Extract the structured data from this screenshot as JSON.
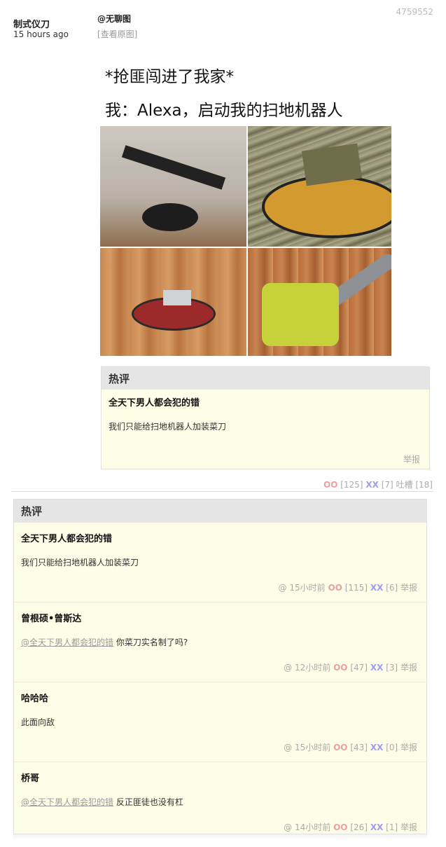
{
  "post": {
    "author": "制式仪刀",
    "time": "15 hours ago",
    "text": "@无聊图",
    "view_original": "[查看原图]",
    "id": "4759552"
  },
  "meme": {
    "line1": "*抢匪闯进了我家*",
    "line2": "我：Alexa，启动我的扫地机器人"
  },
  "hot_comment": {
    "title": "热评",
    "author": "全天下男人都会犯的错",
    "text": "我们只能给扫地机器人加装菜刀",
    "report": "举报"
  },
  "post_votes": {
    "oo_label": "OO",
    "oo_count": "[125]",
    "xx_label": "XX",
    "xx_count": "[7]",
    "tucao_label": "吐槽",
    "tucao_count": "[18]"
  },
  "comments_section": {
    "title": "热评",
    "items": [
      {
        "author": "全天下男人都会犯的错",
        "mention": "",
        "text": "我们只能给扫地机器人加装菜刀",
        "at": "@",
        "time": "15小时前",
        "oo_label": "OO",
        "oo": "[115]",
        "xx_label": "XX",
        "xx": "[6]",
        "report": "举报"
      },
      {
        "author": "曾根硕•曾斯达",
        "mention": "@全天下男人都会犯的错",
        "text": "你菜刀实名制了吗?",
        "at": "@",
        "time": "12小时前",
        "oo_label": "OO",
        "oo": "[47]",
        "xx_label": "XX",
        "xx": "[3]",
        "report": "举报"
      },
      {
        "author": "哈哈哈",
        "mention": "",
        "text": "此面向敌",
        "at": "@",
        "time": "15小时前",
        "oo_label": "OO",
        "oo": "[43]",
        "xx_label": "XX",
        "xx": "[0]",
        "report": "举报"
      },
      {
        "author": "桥哥",
        "mention": "@全天下男人都会犯的错",
        "text": "反正匪徒也没有杠",
        "at": "@",
        "time": "14小时前",
        "oo_label": "OO",
        "oo": "[26]",
        "xx_label": "XX",
        "xx": "[1]",
        "report": "举报"
      }
    ]
  },
  "colors": {
    "oo": "#f29ba0",
    "xx": "#9c9cf2",
    "comment_bg": "#fefee8",
    "header_bg": "#e5e5e5"
  }
}
